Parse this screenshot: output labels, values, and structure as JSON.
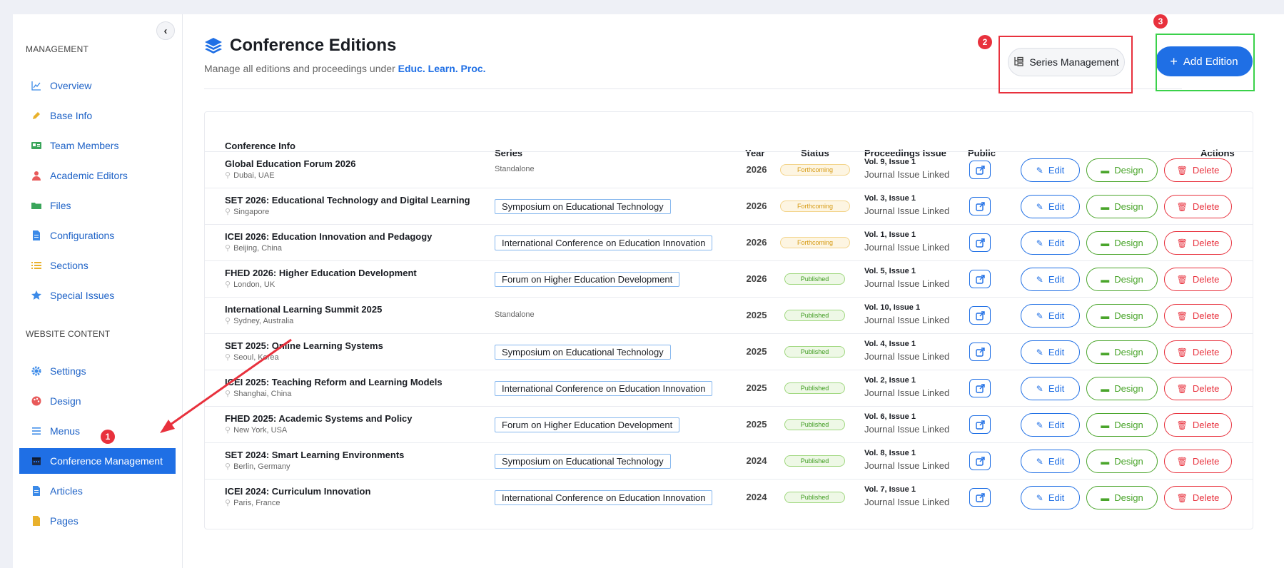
{
  "sidebar": {
    "collapse_icon": "chevron-left-icon",
    "sections": {
      "management": "MANAGEMENT",
      "website": "WEBSITE CONTENT"
    },
    "items": [
      {
        "label": "Overview",
        "icon": "chart-line-icon"
      },
      {
        "label": "Base Info",
        "icon": "pencil-icon"
      },
      {
        "label": "Team Members",
        "icon": "id-card-icon"
      },
      {
        "label": "Academic Editors",
        "icon": "user-tie-icon"
      },
      {
        "label": "Files",
        "icon": "folder-icon"
      },
      {
        "label": "Configurations",
        "icon": "document-icon"
      },
      {
        "label": "Sections",
        "icon": "list-icon"
      },
      {
        "label": "Special Issues",
        "icon": "star-icon"
      },
      {
        "label": "Settings",
        "icon": "gear-icon"
      },
      {
        "label": "Design",
        "icon": "palette-icon"
      },
      {
        "label": "Menus",
        "icon": "menu-icon"
      },
      {
        "label": "Conference Management",
        "icon": "calendar-icon",
        "active": true
      },
      {
        "label": "Articles",
        "icon": "article-icon"
      },
      {
        "label": "Pages",
        "icon": "pages-icon"
      }
    ]
  },
  "header": {
    "title": "Conference Editions",
    "subtitle_prefix": "Manage all editions and proceedings under",
    "subtitle_link": "Educ. Learn. Proc.",
    "series_button": "Series Management",
    "add_button": "Add Edition"
  },
  "annotations": {
    "badge1": "1",
    "badge2": "2",
    "badge3": "3"
  },
  "colors": {
    "accent": "#1f6fe5",
    "success": "#4aa52b",
    "danger": "#e8313d",
    "warning": "#d69a13"
  },
  "table": {
    "headers": {
      "info": "Conference Info",
      "series": "Series",
      "year": "Year",
      "status": "Status",
      "issue": "Proceedings Issue",
      "public": "Public",
      "actions": "Actions"
    },
    "actions": {
      "edit": "Edit",
      "design": "Design",
      "delete": "Delete"
    },
    "linked_text": "Journal Issue Linked",
    "rows": [
      {
        "title": "Global Education Forum 2026",
        "location": "Dubai, UAE",
        "series": "Standalone",
        "standalone": true,
        "year": "2026",
        "status": "Forthcoming",
        "volume": "Vol. 9, Issue 1"
      },
      {
        "title": "SET 2026: Educational Technology and Digital Learning",
        "location": "Singapore",
        "series": "Symposium on Educational Technology",
        "standalone": false,
        "year": "2026",
        "status": "Forthcoming",
        "volume": "Vol. 3, Issue 1"
      },
      {
        "title": "ICEI 2026: Education Innovation and Pedagogy",
        "location": "Beijing, China",
        "series": "International Conference on Education Innovation",
        "standalone": false,
        "year": "2026",
        "status": "Forthcoming",
        "volume": "Vol. 1, Issue 1"
      },
      {
        "title": "FHED 2026: Higher Education Development",
        "location": "London, UK",
        "series": "Forum on Higher Education Development",
        "standalone": false,
        "year": "2026",
        "status": "Published",
        "volume": "Vol. 5, Issue 1"
      },
      {
        "title": "International Learning Summit 2025",
        "location": "Sydney, Australia",
        "series": "Standalone",
        "standalone": true,
        "year": "2025",
        "status": "Published",
        "volume": "Vol. 10, Issue 1"
      },
      {
        "title": "SET 2025: Online Learning Systems",
        "location": "Seoul, Korea",
        "series": "Symposium on Educational Technology",
        "standalone": false,
        "year": "2025",
        "status": "Published",
        "volume": "Vol. 4, Issue 1"
      },
      {
        "title": "ICEI 2025: Teaching Reform and Learning Models",
        "location": "Shanghai, China",
        "series": "International Conference on Education Innovation",
        "standalone": false,
        "year": "2025",
        "status": "Published",
        "volume": "Vol. 2, Issue 1"
      },
      {
        "title": "FHED 2025: Academic Systems and Policy",
        "location": "New York, USA",
        "series": "Forum on Higher Education Development",
        "standalone": false,
        "year": "2025",
        "status": "Published",
        "volume": "Vol. 6, Issue 1"
      },
      {
        "title": "SET 2024: Smart Learning Environments",
        "location": "Berlin, Germany",
        "series": "Symposium on Educational Technology",
        "standalone": false,
        "year": "2024",
        "status": "Published",
        "volume": "Vol. 8, Issue 1"
      },
      {
        "title": "ICEI 2024: Curriculum Innovation",
        "location": "Paris, France",
        "series": "International Conference on Education Innovation",
        "standalone": false,
        "year": "2024",
        "status": "Published",
        "volume": "Vol. 7, Issue 1"
      }
    ]
  }
}
